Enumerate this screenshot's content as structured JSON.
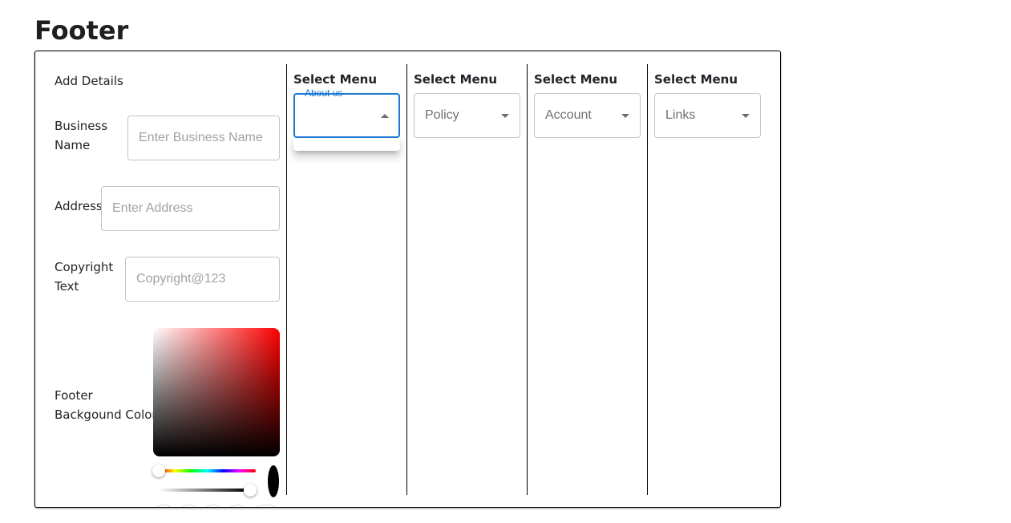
{
  "page": {
    "title": "Footer"
  },
  "details": {
    "heading": "Add Details",
    "business_name": {
      "label_line1": "Business",
      "label_line2": "Name",
      "placeholder": "Enter Business Name",
      "value": ""
    },
    "address": {
      "label": "Address",
      "placeholder": "Enter Address",
      "value": ""
    },
    "copyright": {
      "label_line1": "Copyright",
      "label_line2": "Text",
      "placeholder": "Copyright@123",
      "value": ""
    },
    "bg_color": {
      "label_line1": "Footer",
      "label_line2": "Backgound Color",
      "selected_color": "#000000"
    }
  },
  "menus": [
    {
      "label": "Select Menu",
      "floating_label": "About us",
      "value": "",
      "state": "open"
    },
    {
      "label": "Select Menu",
      "value": "Policy",
      "state": "closed"
    },
    {
      "label": "Select Menu",
      "value": "Account",
      "state": "closed"
    },
    {
      "label": "Select Menu",
      "value": "Links",
      "state": "closed"
    }
  ],
  "colors": {
    "accent": "#1976d2",
    "border": "#c4c4c4",
    "divider": "#000000"
  }
}
